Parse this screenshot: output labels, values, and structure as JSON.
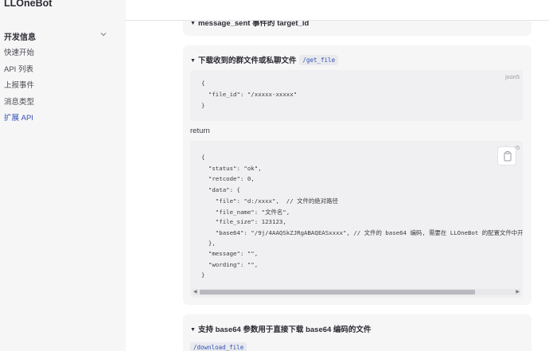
{
  "sidebar": {
    "brand": "LLOneBot",
    "group_title": "开发信息",
    "items": [
      {
        "label": "快速开始"
      },
      {
        "label": "API 列表"
      },
      {
        "label": "上报事件"
      },
      {
        "label": "消息类型"
      },
      {
        "label": "扩展 API"
      }
    ],
    "active_index": 4
  },
  "sections": {
    "message_sent": {
      "title": "message_sent 事件的 target_id"
    },
    "get_file": {
      "title": "下载收到的群文件或私聊文件",
      "endpoint": "/get_file",
      "request_lang": "json5",
      "request_lines": [
        "{",
        "  \"file_id\": \"/xxxxx-xxxxx\"",
        "}"
      ],
      "return_label": "return",
      "response_lang": "json5",
      "response_lines": [
        "{",
        "  \"status\": \"ok\",",
        "  \"retcode\": 0,",
        "  \"data\": {",
        "    \"file\": \"d:/xxxx\",  // 文件的绝对路径",
        "    \"file_name\": \"文件名\",",
        "    \"file_size\": 123123,",
        "    \"base64\": \"/9j/4AAQSkZJRgABAQEASxxxx\", // 文件的 base64 编码, 需要在 LLOneBot 的配置文件中开",
        "  },",
        "  \"message\": \"\",",
        "  \"wording\": \"\",",
        "}"
      ]
    },
    "download_file": {
      "title": "支持 base64 参数用于直接下载 base64 编码的文件",
      "endpoint": "/download_file"
    }
  },
  "icons": {
    "copy": "clipboard-icon",
    "chevron": "chevron-down-icon",
    "toggle": "triangle-down-icon"
  },
  "colors": {
    "accent": "#3451b2",
    "sidebar_bg": "#f6f6f7",
    "card_bg": "#f6f6f7"
  }
}
